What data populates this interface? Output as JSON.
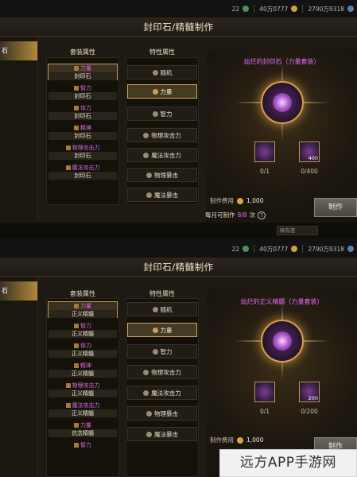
{
  "top": {
    "level": "22",
    "gold_display": "40万0777",
    "currency_display": "2790万9318",
    "window_title": "封印石/精髓制作",
    "left_tab": "石",
    "set_header": "套装属性",
    "spec_header": "特性属性",
    "set_items": [
      {
        "name": "力量",
        "sub": "封印石"
      },
      {
        "name": "智力",
        "sub": "封印石"
      },
      {
        "name": "体力",
        "sub": "封印石"
      },
      {
        "name": "精神",
        "sub": "封印石"
      },
      {
        "name": "物理攻击力",
        "sub": "封印石"
      },
      {
        "name": "魔法攻击力",
        "sub": "封印石"
      }
    ],
    "spec_items": [
      "随机",
      "力量",
      "智力",
      "物理攻击力",
      "魔法攻击力",
      "物理暴击",
      "魔法暴击"
    ],
    "result_title": "灿烂的封印石（力量套装）",
    "mat1_count": "0/1",
    "mat2_count": "0/400",
    "mat2_qty": "400",
    "cost_label": "制作费用",
    "cost_value": "1,000",
    "daily_label": "每月可制作",
    "daily_value": "8/8",
    "daily_suffix": "次",
    "craft_button": "制作",
    "sort_label": "稀有度"
  },
  "bottom": {
    "level": "22",
    "gold_display": "40万0777",
    "currency_display": "2790万9318",
    "window_title": "封印石/精髓制作",
    "left_tab": "石",
    "set_header": "套装属性",
    "spec_header": "特性属性",
    "set_items": [
      {
        "name": "力量",
        "sub": "正义精髓"
      },
      {
        "name": "智力",
        "sub": "正义精髓"
      },
      {
        "name": "体力",
        "sub": "正义精髓"
      },
      {
        "name": "精神",
        "sub": "正义精髓"
      },
      {
        "name": "物理攻击力",
        "sub": "正义精髓"
      },
      {
        "name": "魔法攻击力",
        "sub": "正义精髓"
      },
      {
        "name": "力量",
        "sub": "信念精髓"
      },
      {
        "name": "智力",
        "sub": ""
      }
    ],
    "spec_items": [
      "随机",
      "力量",
      "智力",
      "物理攻击力",
      "魔法攻击力",
      "物理暴击",
      "魔法暴击"
    ],
    "result_title": "灿烂的正义精髓（力量套装）",
    "mat1_count": "0/1",
    "mat2_count": "0/200",
    "mat2_qty": "200",
    "cost_label": "制作费用",
    "cost_value": "1,000",
    "craft_button": "制作"
  },
  "watermark": "远方APP手游网"
}
